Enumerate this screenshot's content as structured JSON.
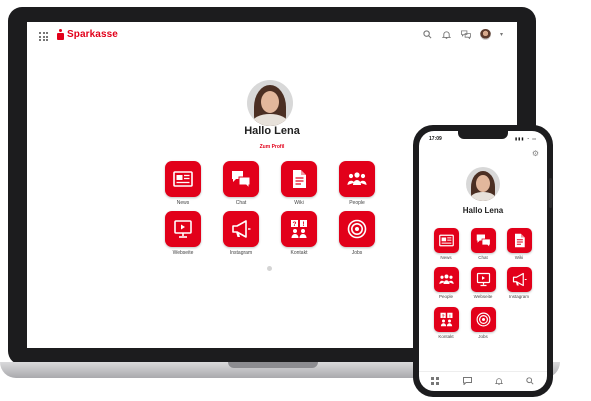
{
  "colors": {
    "brand_red": "#e2001a",
    "device_frame": "#1c1c1e"
  },
  "desktop": {
    "brand": "Sparkasse",
    "top_icons": [
      "search-icon",
      "bell-icon",
      "chat-icon",
      "avatar"
    ],
    "greeting": "Hallo Lena",
    "profile_link": "Zum Profil",
    "tiles": [
      {
        "label": "News",
        "icon": "newspaper-icon"
      },
      {
        "label": "Chat",
        "icon": "chat-bubbles-icon"
      },
      {
        "label": "Wiki",
        "icon": "document-icon"
      },
      {
        "label": "People",
        "icon": "people-icon"
      },
      {
        "label": "Webseite",
        "icon": "monitor-icon"
      },
      {
        "label": "Instagram",
        "icon": "megaphone-icon"
      },
      {
        "label": "Kontakt",
        "icon": "contact-board-icon"
      },
      {
        "label": "Jobs",
        "icon": "target-icon"
      }
    ]
  },
  "mobile": {
    "time": "17:09",
    "greeting": "Hallo Lena",
    "tiles": [
      {
        "label": "News",
        "icon": "newspaper-icon"
      },
      {
        "label": "Chat",
        "icon": "chat-bubbles-icon"
      },
      {
        "label": "Wiki",
        "icon": "document-icon"
      },
      {
        "label": "People",
        "icon": "people-icon"
      },
      {
        "label": "Webseite",
        "icon": "monitor-icon"
      },
      {
        "label": "Instagram",
        "icon": "megaphone-icon"
      },
      {
        "label": "Kontakt",
        "icon": "contact-board-icon"
      },
      {
        "label": "Jobs",
        "icon": "target-icon"
      }
    ],
    "tabbar": [
      "apps-icon",
      "chat-icon",
      "bell-icon",
      "search-icon"
    ]
  }
}
